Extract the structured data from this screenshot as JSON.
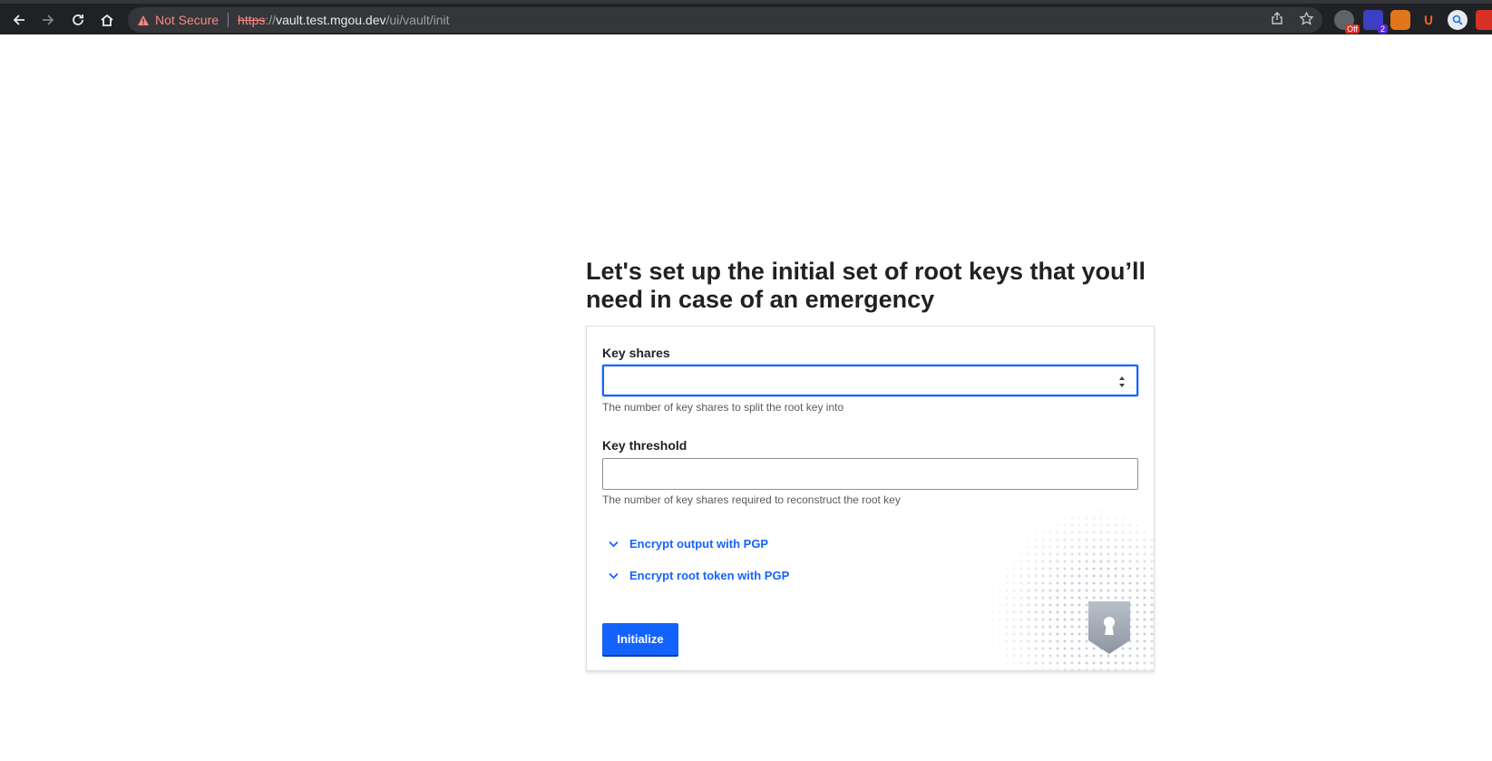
{
  "browser": {
    "security_label": "Not Secure",
    "url_scheme": "https",
    "url_sep": "://",
    "url_host": "vault.test.mgou.dev",
    "url_path": "/ui/vault/init",
    "ext_badge_off": "Off",
    "ext_badge_count": "2"
  },
  "page": {
    "title": "Let's set up the initial set of root keys that you’ll need in case of an emergency"
  },
  "form": {
    "key_shares": {
      "label": "Key shares",
      "value": "",
      "help": "The number of key shares to split the root key into"
    },
    "key_threshold": {
      "label": "Key threshold",
      "value": "",
      "help": "The number of key shares required to reconstruct the root key"
    },
    "toggles": [
      {
        "label": "Encrypt output with PGP"
      },
      {
        "label": "Encrypt root token with PGP"
      }
    ],
    "submit_label": "Initialize"
  },
  "colors": {
    "accent": "#1563ff",
    "warning": "#f28b82",
    "text": "#1f2124"
  }
}
